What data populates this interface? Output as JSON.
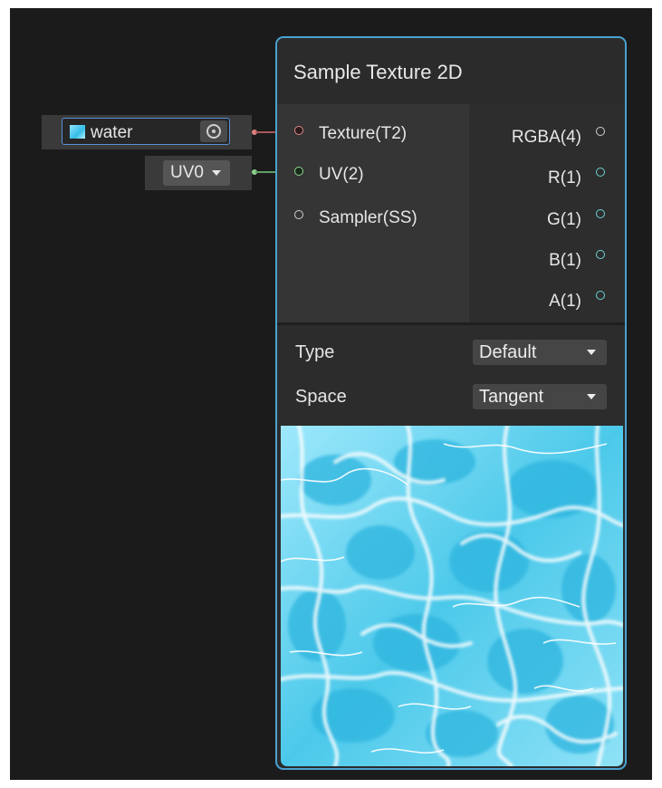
{
  "node": {
    "title": "Sample Texture 2D",
    "inputs": [
      {
        "label": "Texture(T2)"
      },
      {
        "label": "UV(2)"
      },
      {
        "label": "Sampler(SS)"
      }
    ],
    "outputs": [
      {
        "label": "RGBA(4)"
      },
      {
        "label": "R(1)"
      },
      {
        "label": "G(1)"
      },
      {
        "label": "B(1)"
      },
      {
        "label": "A(1)"
      }
    ],
    "properties": [
      {
        "label": "Type",
        "value": "Default"
      },
      {
        "label": "Space",
        "value": "Tangent"
      }
    ]
  },
  "texture_input": {
    "value": "water",
    "thumbnail_icon": "water-texture-thumbnail"
  },
  "uv_input": {
    "value": "UV0"
  },
  "colors": {
    "background": "#1b1b1b",
    "node_border": "#4aa2d0",
    "texture_edge": "#a65858",
    "uv_edge": "#5f9e64",
    "output_port": "#6fd3d3"
  }
}
